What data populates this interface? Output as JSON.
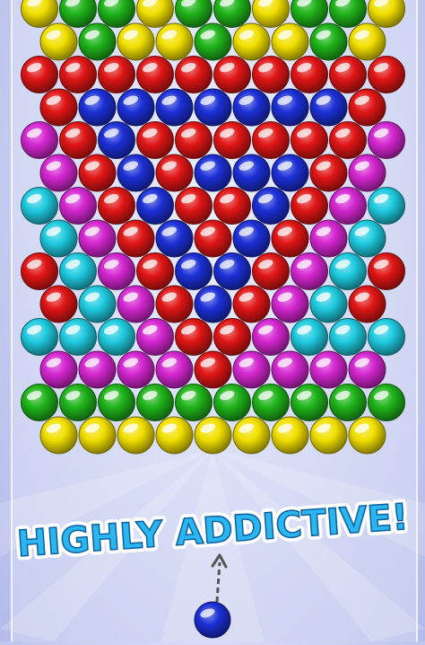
{
  "tagline": "HIGHLY ADDICTIVE!",
  "colors": {
    "yellow": "#f2e000",
    "green": "#1fb41a",
    "red": "#e01515",
    "blue": "#1c2fd6",
    "magenta": "#d426d0",
    "cyan": "#1fcbe0",
    "tagline_fill": "#2cb6f0",
    "tagline_stroke": "#ffffff"
  },
  "grid_rows": [
    [
      "yellow",
      "green",
      "green",
      "yellow",
      "green",
      "green",
      "yellow",
      "green",
      "green",
      "yellow"
    ],
    [
      "yellow",
      "green",
      "yellow",
      "yellow",
      "green",
      "yellow",
      "yellow",
      "green",
      "yellow"
    ],
    [
      "red",
      "red",
      "red",
      "red",
      "red",
      "red",
      "red",
      "red",
      "red",
      "red"
    ],
    [
      "red",
      "blue",
      "blue",
      "blue",
      "blue",
      "blue",
      "blue",
      "blue",
      "red"
    ],
    [
      "magenta",
      "red",
      "blue",
      "red",
      "red",
      "red",
      "red",
      "red",
      "red",
      "magenta"
    ],
    [
      "magenta",
      "red",
      "blue",
      "red",
      "blue",
      "blue",
      "blue",
      "red",
      "magenta"
    ],
    [
      "cyan",
      "magenta",
      "red",
      "blue",
      "red",
      "red",
      "blue",
      "red",
      "magenta",
      "cyan"
    ],
    [
      "cyan",
      "magenta",
      "red",
      "blue",
      "red",
      "blue",
      "red",
      "magenta",
      "cyan"
    ],
    [
      "red",
      "cyan",
      "magenta",
      "red",
      "blue",
      "blue",
      "red",
      "magenta",
      "cyan",
      "red"
    ],
    [
      "red",
      "cyan",
      "magenta",
      "red",
      "blue",
      "red",
      "magenta",
      "cyan",
      "red"
    ],
    [
      "cyan",
      "cyan",
      "cyan",
      "magenta",
      "red",
      "red",
      "magenta",
      "cyan",
      "cyan",
      "cyan"
    ],
    [
      "magenta",
      "magenta",
      "magenta",
      "magenta",
      "red",
      "magenta",
      "magenta",
      "magenta",
      "magenta"
    ],
    [
      "green",
      "green",
      "green",
      "green",
      "green",
      "green",
      "green",
      "green",
      "green",
      "green"
    ],
    [
      "yellow",
      "yellow",
      "yellow",
      "yellow",
      "yellow",
      "yellow",
      "yellow",
      "yellow",
      "yellow"
    ]
  ],
  "shooter": {
    "bubble_color": "blue"
  }
}
